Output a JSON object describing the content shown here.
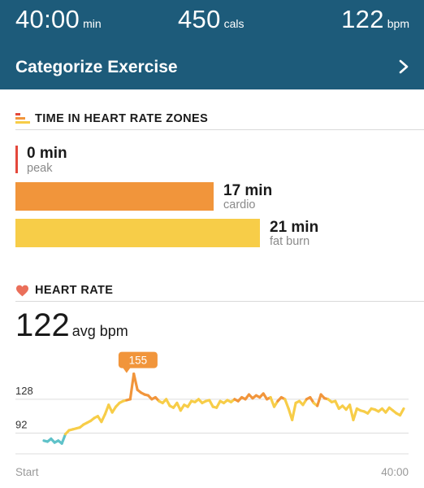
{
  "summary": {
    "duration": {
      "value": "40:00",
      "unit": "min"
    },
    "calories": {
      "value": "450",
      "unit": "cals"
    },
    "avg_bpm": {
      "value": "122",
      "unit": "bpm"
    }
  },
  "categorize": {
    "label": "Categorize Exercise"
  },
  "zones": {
    "title": "TIME IN HEART RATE ZONES",
    "items": [
      {
        "value": "0 min",
        "name": "peak",
        "minutes": 0,
        "color": "#e4483c"
      },
      {
        "value": "17 min",
        "name": "cardio",
        "minutes": 17,
        "color": "#f1953b"
      },
      {
        "value": "21 min",
        "name": "fat burn",
        "minutes": 21,
        "color": "#f7cd48"
      }
    ]
  },
  "heart_rate": {
    "title": "HEART RATE",
    "avg_value": "122",
    "avg_unit": "avg bpm",
    "icon_color": "#ea6f5a"
  },
  "chart_data": {
    "type": "line",
    "title": "",
    "xlabel": "",
    "ylabel": "",
    "x_tick_labels": [
      "Start",
      "40:00"
    ],
    "y_ticks": [
      92,
      128
    ],
    "y_tick_labels": [
      "92",
      "128"
    ],
    "xlim": [
      0,
      40
    ],
    "ylim": [
      70,
      165
    ],
    "peak_label": "155",
    "peak": {
      "x": 9.2,
      "y": 155
    },
    "series": [
      {
        "x": [
          0,
          0.4,
          0.8,
          1.2,
          1.6,
          2.0,
          2.4,
          2.8,
          3.2,
          3.6,
          4.0,
          4.4,
          4.8,
          5.2,
          5.6,
          6.0,
          6.4,
          6.8,
          7.2,
          7.6,
          8.0,
          8.4,
          8.8,
          9.2,
          9.6,
          10.0,
          10.4,
          10.8,
          11.2,
          11.6,
          12.0,
          12.4,
          12.8,
          13.2,
          13.6,
          14.0,
          14.4,
          14.8,
          15.2,
          15.6,
          16.0,
          16.4,
          16.8,
          17.2,
          17.6,
          18.0,
          18.4,
          18.8,
          19.2,
          19.6,
          20.0,
          20.4,
          20.8,
          21.2,
          21.6,
          22.0,
          22.4,
          22.8,
          23.2,
          23.6,
          24.0,
          24.4,
          24.8,
          25.2,
          25.6,
          26.0,
          26.4,
          26.8,
          27.2,
          27.6,
          28.0,
          28.4,
          28.8,
          29.2,
          29.6,
          30.0,
          30.4,
          30.8,
          31.2,
          31.6,
          32.0,
          32.4,
          32.8,
          33.2,
          33.6,
          34.0,
          34.4,
          34.8,
          35.2,
          35.6,
          36.0,
          36.4,
          36.8,
          37.2,
          37.6,
          38.0,
          38.4,
          38.8,
          39.2,
          39.6,
          40.0
        ],
        "values": [
          84,
          83,
          86,
          82,
          84,
          81,
          91,
          95,
          96,
          97,
          98,
          101,
          103,
          105,
          108,
          110,
          104,
          112,
          122,
          114,
          120,
          124,
          126,
          127,
          128,
          155,
          138,
          135,
          133,
          132,
          128,
          130,
          126,
          124,
          128,
          121,
          119,
          124,
          116,
          122,
          120,
          126,
          125,
          128,
          124,
          126,
          127,
          120,
          119,
          126,
          124,
          127,
          125,
          128,
          126,
          130,
          128,
          133,
          129,
          132,
          130,
          134,
          128,
          130,
          120,
          126,
          130,
          128,
          118,
          106,
          124,
          126,
          122,
          128,
          130,
          124,
          121,
          133,
          129,
          128,
          125,
          126,
          118,
          121,
          117,
          122,
          106,
          118,
          116,
          115,
          113,
          118,
          117,
          115,
          118,
          114,
          119,
          116,
          113,
          111,
          118
        ]
      }
    ],
    "line_colors": {
      "low": "#5fc2c9",
      "mid": "#f7cd48",
      "high": "#f1953b"
    }
  },
  "colors": {
    "header_bg": "#1d5b7a",
    "peak": "#e4483c",
    "cardio": "#f1953b",
    "fat_burn": "#f7cd48"
  }
}
